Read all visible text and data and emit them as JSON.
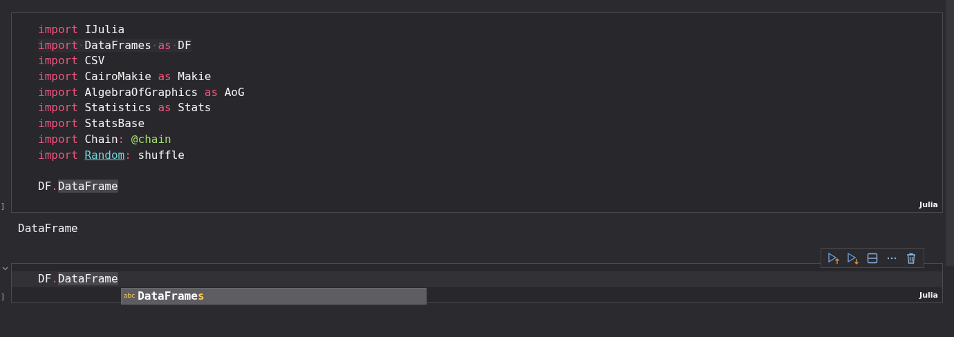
{
  "cells": [
    {
      "kind": "code",
      "marker": "]",
      "language": "Julia",
      "lines": [
        {
          "kind": "code",
          "tokens": [
            {
              "text": "import",
              "kind": "keyword"
            },
            {
              "text": " IJulia",
              "kind": "plain"
            }
          ]
        },
        {
          "kind": "code",
          "tokens": [
            {
              "text": "import",
              "kind": "keyword"
            },
            {
              "text": "·",
              "kind": "space"
            },
            {
              "text": "DataFrames",
              "kind": "plain"
            },
            {
              "text": "·",
              "kind": "space"
            },
            {
              "text": "as",
              "kind": "keyword"
            },
            {
              "text": "·",
              "kind": "space"
            },
            {
              "text": "DF",
              "kind": "plain"
            }
          ]
        },
        {
          "kind": "code",
          "tokens": [
            {
              "text": "import",
              "kind": "keyword"
            },
            {
              "text": " CSV",
              "kind": "plain"
            }
          ]
        },
        {
          "kind": "code",
          "tokens": [
            {
              "text": "import",
              "kind": "keyword"
            },
            {
              "text": " CairoMakie ",
              "kind": "plain"
            },
            {
              "text": "as",
              "kind": "keyword"
            },
            {
              "text": " Makie",
              "kind": "plain"
            }
          ]
        },
        {
          "kind": "code",
          "tokens": [
            {
              "text": "import",
              "kind": "keyword"
            },
            {
              "text": " AlgebraOfGraphics ",
              "kind": "plain"
            },
            {
              "text": "as",
              "kind": "keyword"
            },
            {
              "text": " AoG",
              "kind": "plain"
            }
          ]
        },
        {
          "kind": "code",
          "tokens": [
            {
              "text": "import",
              "kind": "keyword"
            },
            {
              "text": " Statistics ",
              "kind": "plain"
            },
            {
              "text": "as",
              "kind": "keyword"
            },
            {
              "text": " Stats",
              "kind": "plain"
            }
          ]
        },
        {
          "kind": "code",
          "tokens": [
            {
              "text": "import",
              "kind": "keyword"
            },
            {
              "text": " StatsBase",
              "kind": "plain"
            }
          ]
        },
        {
          "kind": "code",
          "tokens": [
            {
              "text": "import",
              "kind": "keyword"
            },
            {
              "text": " Chain",
              "kind": "plain"
            },
            {
              "text": ": ",
              "kind": "punct"
            },
            {
              "text": "@chain",
              "kind": "macro"
            }
          ]
        },
        {
          "kind": "code",
          "tokens": [
            {
              "text": "import ",
              "kind": "keyword"
            },
            {
              "text": "Random",
              "kind": "module"
            },
            {
              "text": ": ",
              "kind": "punct"
            },
            {
              "text": "shuffle",
              "kind": "plain"
            }
          ]
        },
        {
          "kind": "blank"
        },
        {
          "kind": "code",
          "tokens": [
            {
              "text": "DF",
              "kind": "plain"
            },
            {
              "text": ".",
              "kind": "punct"
            },
            {
              "text": "DataFrame",
              "kind": "selected"
            }
          ]
        }
      ],
      "output": "DataFrame"
    },
    {
      "kind": "code",
      "marker": "]",
      "language": "Julia",
      "lines": [
        {
          "kind": "code",
          "tokens": [
            {
              "text": "DF",
              "kind": "plain"
            },
            {
              "text": ".",
              "kind": "punct"
            },
            {
              "text": "DataFrame",
              "kind": "selected"
            }
          ]
        }
      ],
      "suggestion": {
        "icon": "abc",
        "matched": "DataFrame",
        "rest": "s"
      },
      "toolbar": [
        {
          "kind": "run_above"
        },
        {
          "kind": "run_below"
        },
        {
          "kind": "split"
        },
        {
          "kind": "more"
        },
        {
          "kind": "delete"
        }
      ]
    }
  ]
}
